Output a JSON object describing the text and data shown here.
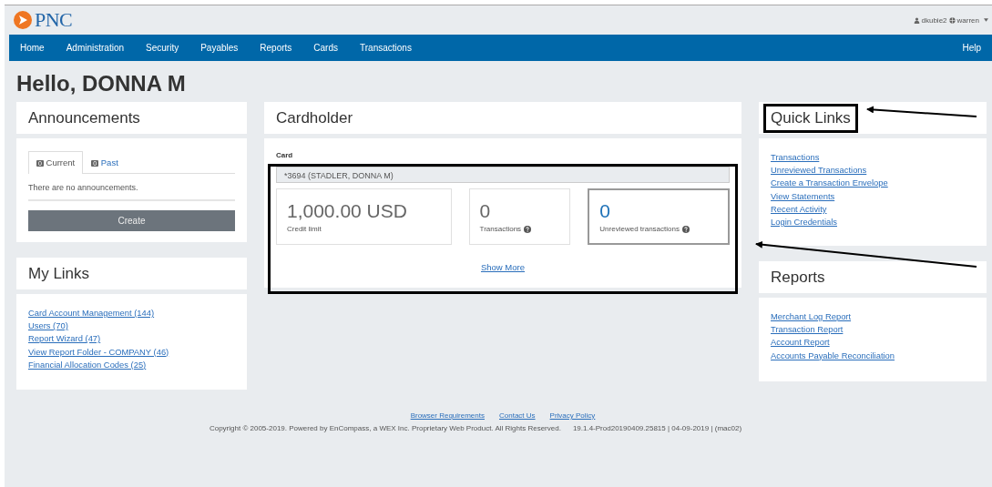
{
  "header": {
    "logo": "PNC",
    "user": "dkubie2",
    "org": "warren"
  },
  "nav": {
    "items": [
      "Home",
      "Administration",
      "Security",
      "Payables",
      "Reports",
      "Cards",
      "Transactions"
    ],
    "help": "Help"
  },
  "greeting": "Hello, DONNA M",
  "announcements": {
    "title": "Announcements",
    "tabs": [
      {
        "count": "0",
        "label": "Current",
        "selected": true
      },
      {
        "count": "0",
        "label": "Past",
        "selected": false
      }
    ],
    "empty_text": "There are no announcements.",
    "button": "Create"
  },
  "my_links": {
    "title": "My Links",
    "links": [
      "Card Account Management (144)",
      "Users (70)",
      "Report Wizard (47)",
      "View Report Folder - COMPANY (46)",
      "Financial Allocation Codes (25)"
    ]
  },
  "cardholder": {
    "title": "Cardholder",
    "card_label": "Card",
    "card_value": "*3694 (STADLER, DONNA M)",
    "stats": [
      {
        "value": "1,000.00 USD",
        "label": "Credit limit",
        "help": false,
        "highlight": false
      },
      {
        "value": "0",
        "label": "Transactions",
        "help": true,
        "highlight": false
      },
      {
        "value": "0",
        "label": "Unreviewed transactions",
        "help": true,
        "highlight": true
      }
    ],
    "show_more": "Show More"
  },
  "quick_links": {
    "title": "Quick Links",
    "links": [
      "Transactions",
      "Unreviewed Transactions",
      "Create a Transaction Envelope",
      "View Statements",
      "Recent Activity",
      "Login Credentials"
    ]
  },
  "reports": {
    "title": "Reports",
    "links": [
      "Merchant Log Report",
      "Transaction Report",
      "Account Report",
      "Accounts Payable Reconciliation"
    ]
  },
  "footer": {
    "links": [
      "Browser Requirements",
      "Contact Us",
      "Privacy Policy"
    ],
    "copyright": "Copyright © 2005-2019. Powered by EnCompass, a WEX Inc. Proprietary Web Product. All Rights Reserved.",
    "version": "19.1.4-Prod20190409.25815 | 04-09-2019 | (mac02)"
  }
}
